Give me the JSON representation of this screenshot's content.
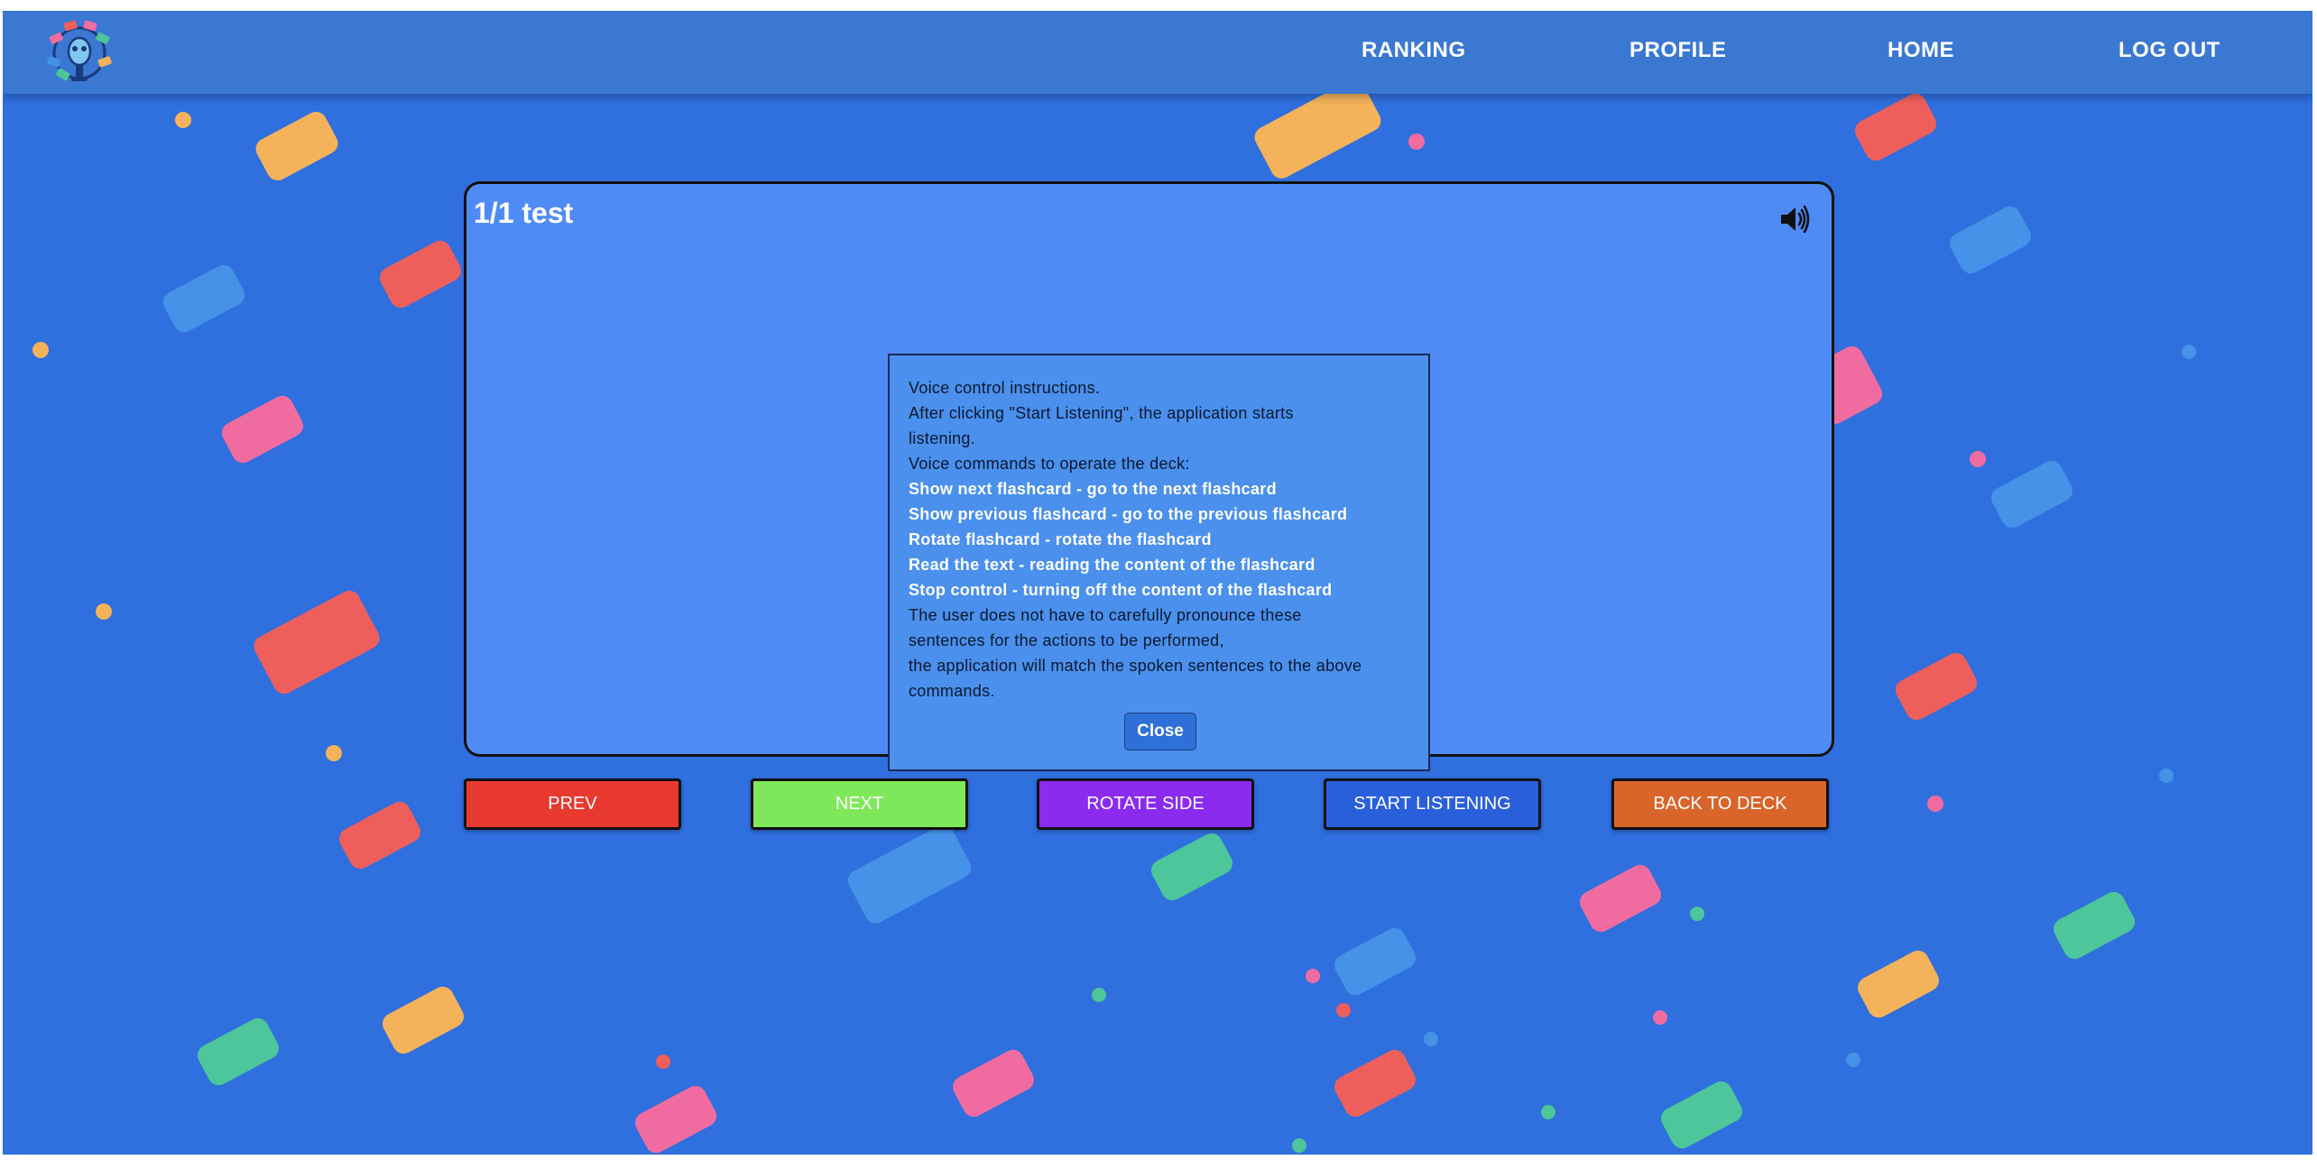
{
  "nav": {
    "logo_icon": "microphone-robot-logo-icon",
    "links": [
      "RANKING",
      "PROFILE",
      "HOME",
      "LOG OUT"
    ]
  },
  "card": {
    "title": "1/1 test",
    "speaker_icon": "speaker-volume-icon"
  },
  "modal": {
    "lines": [
      "Voice control instructions.",
      "After clicking \"Start Listening\", the application starts",
      "listening.",
      "Voice commands to operate the deck:",
      "Show next flashcard - go to the next flashcard",
      "Show previous flashcard - go to the previous flashcard",
      "Rotate flashcard - rotate the flashcard",
      "Read the text - reading the content of the flashcard",
      "Stop control - turning off the content of the flashcard",
      "The user does not have to carefully pronounce these",
      "sentences for the actions to be performed,",
      "the application will match the spoken sentences to the above",
      "commands."
    ],
    "close_label": "Close"
  },
  "buttons": {
    "prev": "PREV",
    "next": "NEXT",
    "rotate": "ROTATE SIDE",
    "listen": "START LISTENING",
    "back": "BACK TO DECK"
  },
  "colors": {
    "background": "#2f6fde",
    "navbar": "#3a78d2",
    "card": "#4f8bf5",
    "modal": "#4a90ec",
    "prev": "#e8392f",
    "next": "#7fe85a",
    "rotate": "#8b2bf0",
    "listen": "#2a5fdc",
    "back": "#d9652b"
  }
}
